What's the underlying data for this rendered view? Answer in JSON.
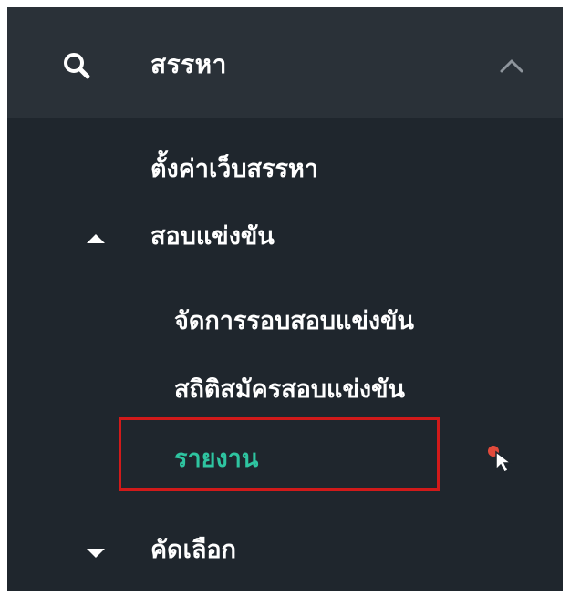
{
  "header": {
    "title": "สรรหา",
    "search_icon": "search-icon",
    "collapse_icon": "chevron-up-icon"
  },
  "menu": {
    "settings_label": "ตั้งค่าเว็บสรรหา",
    "competition_label": "สอบแข่งขัน",
    "competition_expanded": true,
    "competition_items": [
      {
        "label": "จัดการรอบสอบแข่งขัน",
        "active": false
      },
      {
        "label": "สถิติสมัครสอบแข่งขัน",
        "active": false
      },
      {
        "label": "รายงาน",
        "active": true
      }
    ],
    "selection_label": "คัดเลือก",
    "selection_expanded": false
  },
  "colors": {
    "panel_bg": "#1f262d",
    "header_bg": "#2a3138",
    "text": "#ffffff",
    "active_text": "#2ec4a0",
    "highlight_border": "#d11a1a"
  },
  "icons": {
    "expanded_caret": "caret-up-icon",
    "collapsed_caret": "caret-down-icon",
    "cursor": "cursor-pointer-icon"
  }
}
